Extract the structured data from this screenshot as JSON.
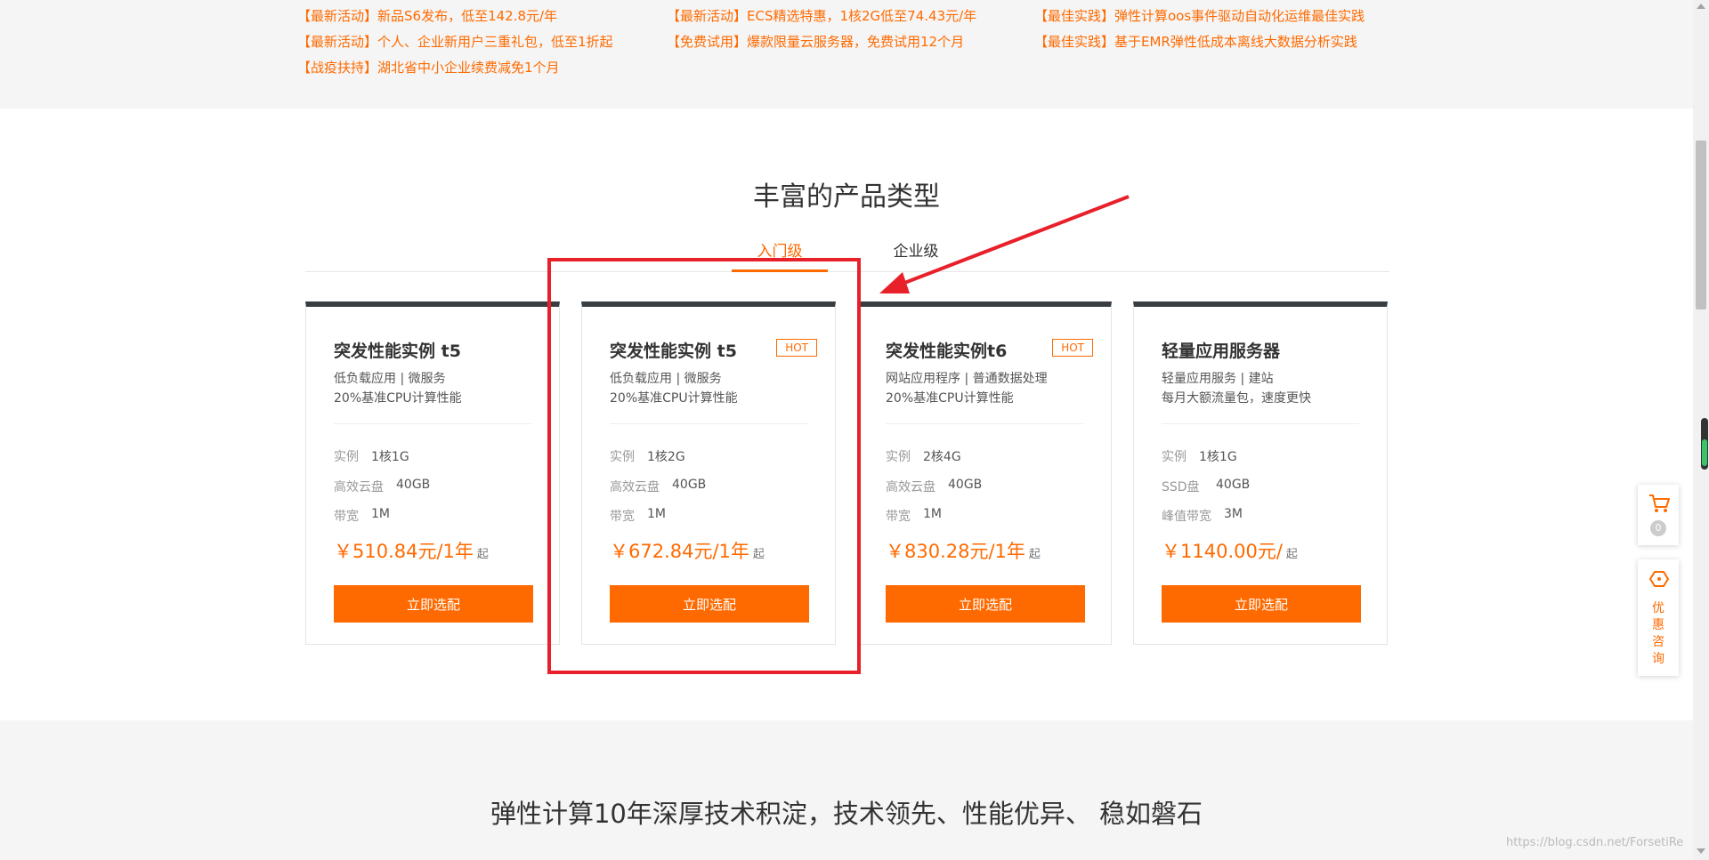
{
  "promo": {
    "links": [
      "【最新活动】新品S6发布，低至142.8元/年",
      "【最新活动】ECS精选特惠，1核2G低至74.43元/年",
      "【最佳实践】弹性计算oos事件驱动自动化运维最佳实践",
      "【最新活动】个人、企业新用户三重礼包，低至1折起",
      "【免费试用】爆款限量云服务器，免费试用12个月",
      "【最佳实践】基于EMR弹性低成本离线大数据分析实践",
      "【战疫扶持】湖北省中小企业续费减免1个月"
    ]
  },
  "products": {
    "title": "丰富的产品类型",
    "tabs": [
      "入门级",
      "企业级"
    ],
    "cards": [
      {
        "name": "突发性能实例 t5",
        "hot": "",
        "desc1": "低负载应用 | 微服务",
        "desc2": "20%基准CPU计算性能",
        "specs": [
          {
            "key": "实例",
            "value": "1核1G"
          },
          {
            "key": "高效云盘",
            "value": "40GB"
          },
          {
            "key": "带宽",
            "value": "1M"
          }
        ],
        "price": "￥510.84元/1年",
        "from": "起",
        "button": "立即选配"
      },
      {
        "name": "突发性能实例 t5",
        "hot": "HOT",
        "desc1": "低负载应用 | 微服务",
        "desc2": "20%基准CPU计算性能",
        "specs": [
          {
            "key": "实例",
            "value": "1核2G"
          },
          {
            "key": "高效云盘",
            "value": "40GB"
          },
          {
            "key": "带宽",
            "value": "1M"
          }
        ],
        "price": "￥672.84元/1年",
        "from": "起",
        "button": "立即选配"
      },
      {
        "name": "突发性能实例t6",
        "hot": "HOT",
        "desc1": "网站应用程序 | 普通数据处理",
        "desc2": "20%基准CPU计算性能",
        "specs": [
          {
            "key": "实例",
            "value": "2核4G"
          },
          {
            "key": "高效云盘",
            "value": "40GB"
          },
          {
            "key": "带宽",
            "value": "1M"
          }
        ],
        "price": "￥830.28元/1年",
        "from": "起",
        "button": "立即选配"
      },
      {
        "name": "轻量应用服务器",
        "hot": "",
        "desc1": "轻量应用服务 | 建站",
        "desc2": "每月大额流量包，速度更快",
        "specs": [
          {
            "key": "实例",
            "value": "1核1G"
          },
          {
            "key": "SSD盘",
            "value": "40GB"
          },
          {
            "key": "峰值带宽",
            "value": "3M"
          }
        ],
        "price": "￥1140.00元/",
        "from": "起",
        "button": "立即选配"
      }
    ]
  },
  "tech": {
    "title": "弹性计算10年深厚技术积淀，技术领先、性能优异、 稳如磐石"
  },
  "side": {
    "cart_count": "0",
    "consult": "优惠咨询"
  },
  "watermark": "https://blog.csdn.net/ForsetiRe",
  "colors": {
    "accent": "#ff6a00",
    "annotation": "#e8202a",
    "card_top": "#373d41"
  }
}
